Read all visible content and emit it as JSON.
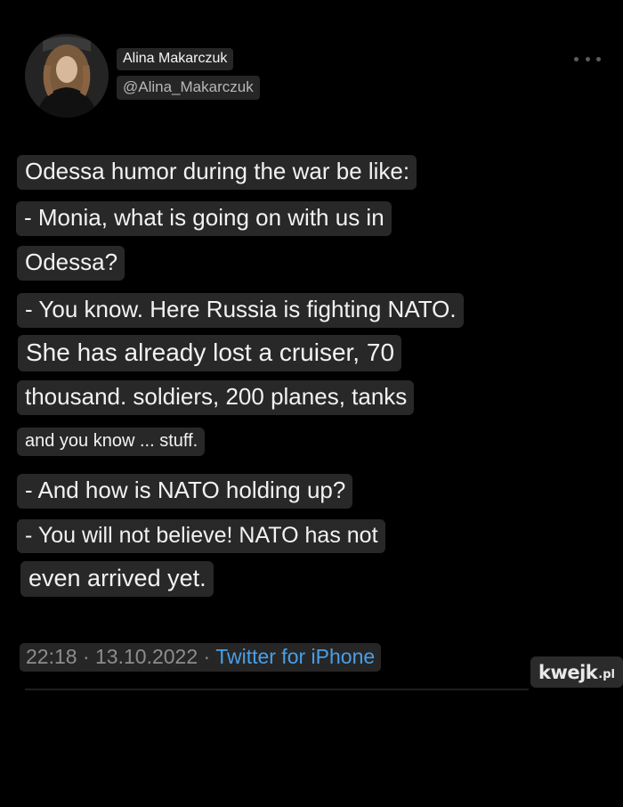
{
  "author": {
    "name": "Alina Makarczuk",
    "handle": "@Alina_Makarczuk"
  },
  "tweet": {
    "lines": [
      "Odessa humor during the war be like:",
      "- Monia, what is going on with us in",
      "Odessa?",
      "- You know. Here Russia is fighting NATO.",
      "She has already lost a cruiser, 70",
      "thousand. soldiers, 200 planes, tanks",
      "and you know ... stuff.",
      "- And how is NATO holding up?",
      "- You will not believe! NATO has not",
      "even arrived yet."
    ],
    "time": "22:18",
    "separator": "·",
    "date": "13.10.2022",
    "source": "Twitter for iPhone"
  },
  "watermark": {
    "text_main": "kwejk",
    "text_tld": ".pl"
  },
  "icons": {
    "more": "more-options-icon",
    "avatar": "profile-photo"
  },
  "colors": {
    "background": "#000000",
    "chip": "#282828",
    "link": "#4a9fe8",
    "muted": "#8d8d8d"
  }
}
